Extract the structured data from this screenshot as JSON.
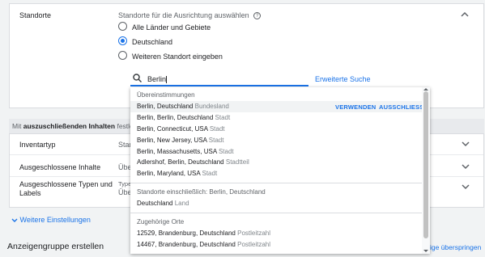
{
  "locations": {
    "section_label": "Standorte",
    "question": "Standorte für die Ausrichtung auswählen",
    "options": [
      {
        "label": "Alle Länder und Gebiete",
        "selected": false
      },
      {
        "label": "Deutschland",
        "selected": true
      },
      {
        "label": "Weiteren Standort eingeben",
        "selected": false
      }
    ],
    "search_value": "Berlin",
    "advanced_search": "Erweiterte Suche"
  },
  "exclusions_header": {
    "prefix": "Mit",
    "bold": "auszuschließenden Inhalten",
    "suffix": "festle"
  },
  "settings_rows": [
    {
      "label": "Inventartyp",
      "value": "Stan"
    },
    {
      "label": "Ausgeschlossene Inhalte",
      "value": "Übe"
    },
    {
      "label": "Ausgeschlossene Typen und Labels",
      "value_line1": "Type",
      "value_line2": "Übe"
    }
  ],
  "more_settings": "Weitere Einstellungen",
  "ad_group": {
    "title": "Anzeigengruppe erstellen",
    "skip": "ige überspringen"
  },
  "dropdown": {
    "matches_title": "Übereinstimmungen",
    "actions": {
      "use": "VERWENDEN",
      "exclude": "AUSSCHLIESSE"
    },
    "matches": [
      {
        "name": "Berlin, Deutschland",
        "type": "Bundesland"
      },
      {
        "name": "Berlin, Berlin, Deutschland",
        "type": "Stadt"
      },
      {
        "name": "Berlin, Connecticut, USA",
        "type": "Stadt"
      },
      {
        "name": "Berlin, New Jersey, USA",
        "type": "Stadt"
      },
      {
        "name": "Berlin, Massachusetts, USA",
        "type": "Stadt"
      },
      {
        "name": "Adlershof, Berlin, Deutschland",
        "type": "Stadtteil"
      },
      {
        "name": "Berlin, Maryland, USA",
        "type": "Stadt"
      }
    ],
    "containing_title": "Standorte einschließlich: Berlin, Deutschland",
    "containing": [
      {
        "name": "Deutschland",
        "type": "Land"
      }
    ],
    "related_title": "Zugehörige Orte",
    "related": [
      {
        "name": "12529, Brandenburg, Deutschland",
        "type": "Postleitzahl"
      },
      {
        "name": "14467, Brandenburg, Deutschland",
        "type": "Postleitzahl"
      }
    ]
  },
  "colors": {
    "accent": "#1a73e8",
    "background": "#f1f3f4"
  }
}
